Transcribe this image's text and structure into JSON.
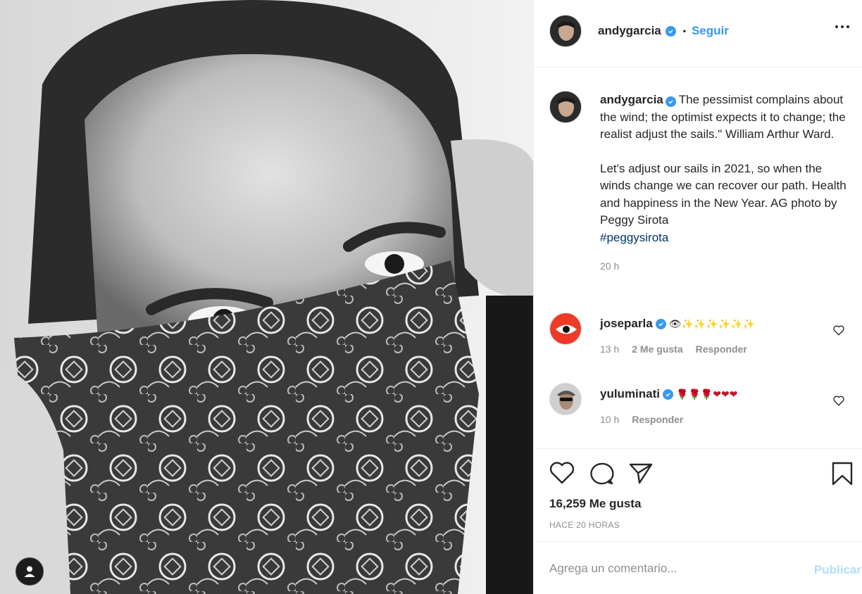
{
  "post": {
    "author": "andygarcia",
    "separator": "•",
    "follow_label": "Seguir",
    "more_options_icon": "more-horizontal-icon"
  },
  "caption": {
    "username": "andygarcia",
    "quote": "The pessimist complains about the wind; the optimist expects it to change; the realist adjust the sails.\" William Arthur Ward.",
    "body": "Let's adjust our sails in 2021, so when the winds change we can recover our path. Health and happiness in the New Year. AG photo by Peggy Sirota",
    "hashtag": "#peggysirota",
    "time": "20 h"
  },
  "comments": [
    {
      "username": "joseparla",
      "text": "👁✨✨✨✨✨✨",
      "time": "13 h",
      "likes": "2 Me gusta",
      "reply": "Responder"
    },
    {
      "username": "yuluminati",
      "text": "🌹🌹🌹❤❤❤",
      "time": "10 h",
      "reply": "Responder"
    }
  ],
  "actions": {
    "likes": "16,259 Me gusta",
    "posted_ago": "HACE 20 HORAS"
  },
  "comment_box": {
    "placeholder": "Agrega un comentario...",
    "publish_label": "Publicar"
  },
  "colors": {
    "accent": "#3897f0",
    "muted": "#8e8e8e",
    "publish_disabled": "#b2dffc"
  }
}
